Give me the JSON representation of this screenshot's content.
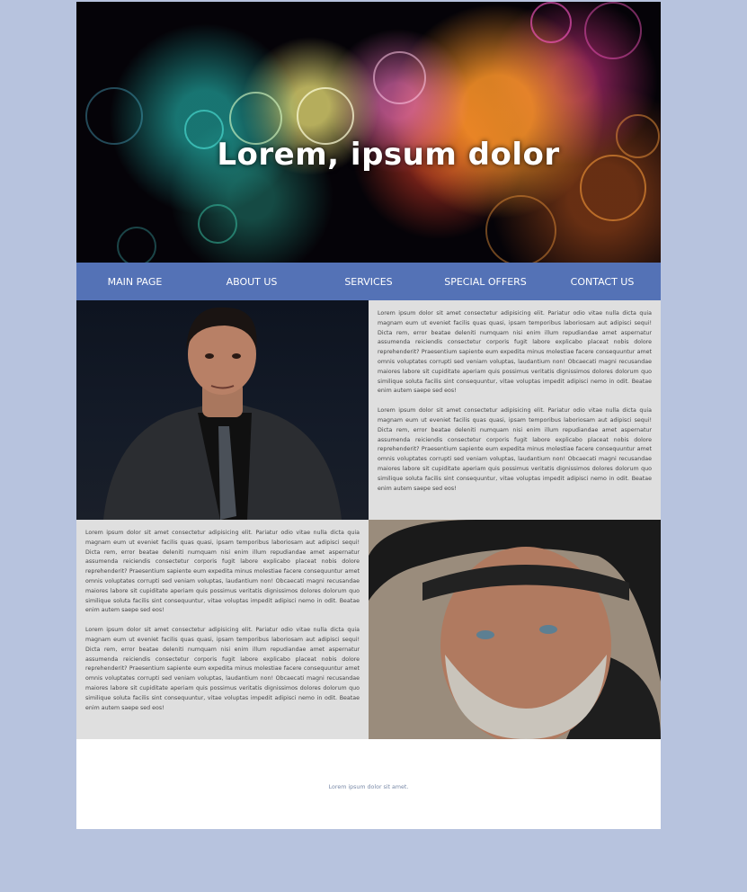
{
  "header": {
    "title": "Lorem, ipsum dolor"
  },
  "nav": {
    "items": [
      {
        "label": "MAIN PAGE"
      },
      {
        "label": "ABOUT US"
      },
      {
        "label": "SERVICES"
      },
      {
        "label": "SPECIAL OFFERS"
      },
      {
        "label": "CONTACT US"
      }
    ]
  },
  "section1": {
    "photo_icon": "man-in-suit-photo",
    "paragraphs": [
      "Lorem ipsum dolor sit amet consectetur adipisicing elit. Pariatur odio vitae nulla dicta quia magnam eum ut eveniet facilis quas quasi, ipsam temporibus laboriosam aut adipisci sequi! Dicta rem, error beatae deleniti numquam nisi enim illum repudiandae amet aspernatur assumenda reiciendis consectetur corporis fugit labore explicabo placeat nobis dolore reprehenderit? Praesentium sapiente eum expedita minus molestiae facere consequuntur amet omnis voluptates corrupti sed veniam voluptas, laudantium non! Obcaecati magni recusandae maiores labore sit cupiditate aperiam quis possimus veritatis dignissimos dolores dolorum quo similique soluta facilis sint consequuntur, vitae voluptas impedit adipisci nemo in odit. Beatae enim autem saepe sed eos!",
      "Lorem ipsum dolor sit amet consectetur adipisicing elit. Pariatur odio vitae nulla dicta quia magnam eum ut eveniet facilis quas quasi, ipsam temporibus laboriosam aut adipisci sequi! Dicta rem, error beatae deleniti numquam nisi enim illum repudiandae amet aspernatur assumenda reiciendis consectetur corporis fugit labore explicabo placeat nobis dolore reprehenderit? Praesentium sapiente eum expedita minus molestiae facere consequuntur amet omnis voluptates corrupti sed veniam voluptas, laudantium non! Obcaecati magni recusandae maiores labore sit cupiditate aperiam quis possimus veritatis dignissimos dolores dolorum quo similique soluta facilis sint consequuntur, vitae voluptas impedit adipisci nemo in odit. Beatae enim autem saepe sed eos!"
    ]
  },
  "section2": {
    "photo_icon": "man-with-hat-photo",
    "paragraphs": [
      "Lorem ipsum dolor sit amet consectetur adipisicing elit. Pariatur odio vitae nulla dicta quia magnam eum ut eveniet facilis quas quasi, ipsam temporibus laboriosam aut adipisci sequi! Dicta rem, error beatae deleniti numquam nisi enim illum repudiandae amet aspernatur assumenda reiciendis consectetur corporis fugit labore explicabo placeat nobis dolore reprehenderit? Praesentium sapiente eum expedita minus molestiae facere consequuntur amet omnis voluptates corrupti sed veniam voluptas, laudantium non! Obcaecati magni recusandae maiores labore sit cupiditate aperiam quis possimus veritatis dignissimos dolores dolorum quo similique soluta facilis sint consequuntur, vitae voluptas impedit adipisci nemo in odit. Beatae enim autem saepe sed eos!",
      "Lorem ipsum dolor sit amet consectetur adipisicing elit. Pariatur odio vitae nulla dicta quia magnam eum ut eveniet facilis quas quasi, ipsam temporibus laboriosam aut adipisci sequi! Dicta rem, error beatae deleniti numquam nisi enim illum repudiandae amet aspernatur assumenda reiciendis consectetur corporis fugit labore explicabo placeat nobis dolore reprehenderit? Praesentium sapiente eum expedita minus molestiae facere consequuntur amet omnis voluptates corrupti sed veniam voluptas, laudantium non! Obcaecati magni recusandae maiores labore sit cupiditate aperiam quis possimus veritatis dignissimos dolores dolorum quo similique soluta facilis sint consequuntur, vitae voluptas impedit adipisci nemo in odit. Beatae enim autem saepe sed eos!"
    ]
  },
  "footer": {
    "text": "Lorem ipsum dolor sit amet."
  },
  "colors": {
    "page_background": "#b7c3de",
    "nav_background": "#5472b6",
    "text_panel_background": "#dfdfdf"
  }
}
